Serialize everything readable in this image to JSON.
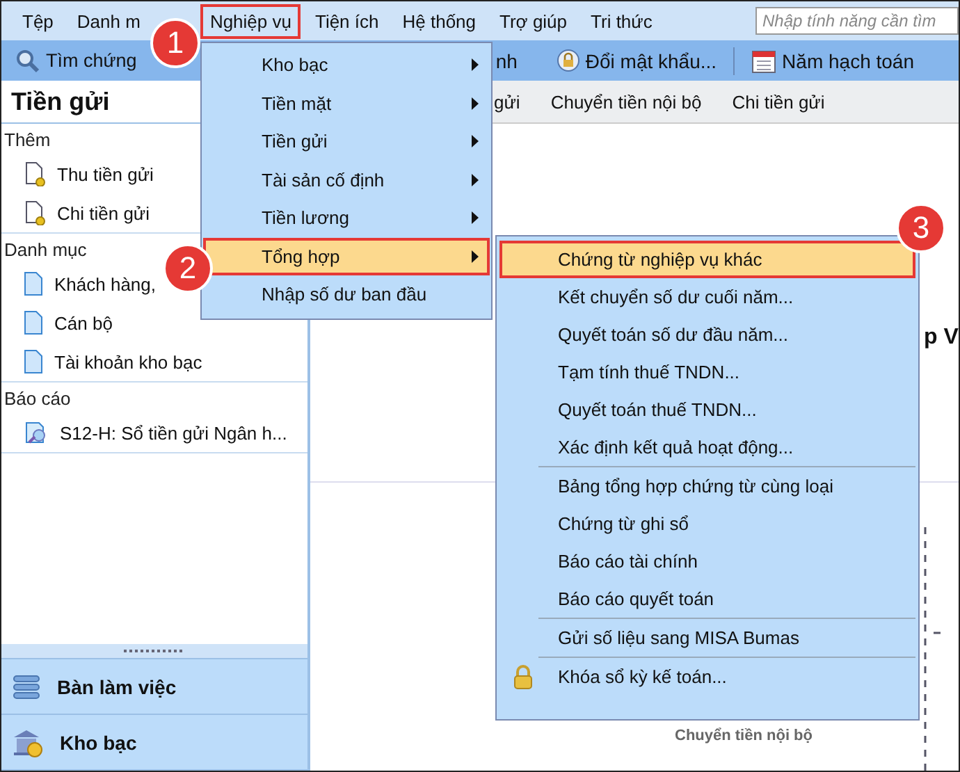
{
  "menubar": {
    "items": [
      {
        "label": "Tệp",
        "selected": false
      },
      {
        "label": "Danh m",
        "selected": false
      },
      {
        "label": "Nghiệp vụ",
        "selected": true
      },
      {
        "label": "Tiện ích",
        "selected": false
      },
      {
        "label": "Hệ thống",
        "selected": false
      },
      {
        "label": "Trợ giúp",
        "selected": false
      },
      {
        "label": "Tri thức",
        "selected": false
      }
    ],
    "search": {
      "placeholder": "Nhập tính năng cần tìm"
    }
  },
  "toolbar": {
    "items": [
      {
        "label": "Tìm chứng",
        "kind": "search"
      },
      {
        "label": "nh",
        "kind": "plain"
      },
      {
        "label": "Đổi mật khẩu...",
        "kind": "lock"
      },
      {
        "label": "Năm hạch toán",
        "kind": "calendar"
      }
    ]
  },
  "panel": {
    "title": "Tiền gửi",
    "sections": [
      {
        "heading": "Thêm",
        "items": [
          {
            "label": "Thu tiền gửi",
            "kind": "voucher"
          },
          {
            "label": "Chi tiền gửi",
            "kind": "voucher"
          }
        ]
      },
      {
        "heading": "Danh mục",
        "items": [
          {
            "label": "Khách hàng,",
            "kind": "page"
          },
          {
            "label": "Cán bộ",
            "kind": "page"
          },
          {
            "label": "Tài khoản kho bạc",
            "kind": "page"
          }
        ]
      },
      {
        "heading": "Báo cáo",
        "items": [
          {
            "label": "S12-H: Sổ tiền gửi Ngân h...",
            "kind": "report"
          }
        ]
      }
    ]
  },
  "nav_buttons": [
    {
      "label": "Bàn làm việc",
      "kind": "desk"
    },
    {
      "label": "Kho bạc",
      "kind": "bank"
    }
  ],
  "tabs": [
    {
      "label": "gửi"
    },
    {
      "label": "Chuyển tiền nội bộ"
    },
    {
      "label": "Chi tiền gửi"
    }
  ],
  "content": {
    "heading": "p V",
    "diagram_label": "Chuyển tiền nội bộ"
  },
  "menu": {
    "items": [
      {
        "label": "Kho bạc",
        "submenu": true,
        "selected": false
      },
      {
        "label": "Tiền mặt",
        "submenu": true,
        "selected": false
      },
      {
        "label": "Tiền gửi",
        "submenu": true,
        "selected": false
      },
      {
        "label": "Tài sản cố định",
        "submenu": true,
        "selected": false
      },
      {
        "label": "Tiền lương",
        "submenu": true,
        "selected": false
      },
      {
        "label": "Tổng hợp",
        "submenu": true,
        "selected": true
      },
      {
        "label": "Nhập số dư ban đầu",
        "submenu": false,
        "selected": false
      }
    ]
  },
  "submenu": {
    "groups": [
      [
        {
          "label": "Chứng từ nghiệp vụ khác",
          "kind": "plain",
          "selected": true
        },
        {
          "label": "Kết chuyển số dư cuối năm...",
          "kind": "plain",
          "selected": false
        },
        {
          "label": "Quyết toán số dư đầu năm...",
          "kind": "plain",
          "selected": false
        },
        {
          "label": "Tạm tính thuế TNDN...",
          "kind": "plain",
          "selected": false
        },
        {
          "label": "Quyết toán thuế TNDN...",
          "kind": "plain",
          "selected": false
        },
        {
          "label": "Xác định kết quả hoạt động...",
          "kind": "plain",
          "selected": false
        }
      ],
      [
        {
          "label": "Bảng tổng hợp chứng từ cùng loại",
          "kind": "plain",
          "selected": false
        },
        {
          "label": "Chứng từ ghi sổ",
          "kind": "plain",
          "selected": false
        },
        {
          "label": "Báo cáo tài chính",
          "kind": "plain",
          "selected": false
        },
        {
          "label": "Báo cáo quyết toán",
          "kind": "plain",
          "selected": false
        }
      ],
      [
        {
          "label": "Gửi số liệu sang MISA Bumas",
          "kind": "plain",
          "selected": false
        }
      ],
      [
        {
          "label": "Khóa sổ kỳ kế toán...",
          "kind": "lock",
          "selected": false
        }
      ]
    ]
  },
  "callouts": [
    "1",
    "2",
    "3"
  ]
}
